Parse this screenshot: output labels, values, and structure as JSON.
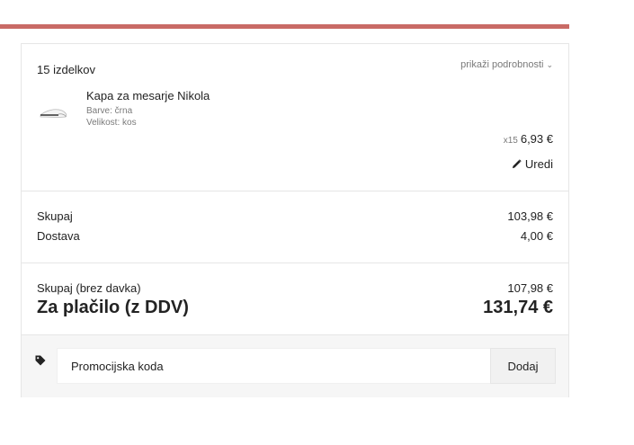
{
  "colors": {
    "accent_bar": "#c96b66"
  },
  "cart": {
    "items_count": "15 izdelkov",
    "show_details": "prikaži podrobnosti",
    "product": {
      "name": "Kapa za mesarje Nikola",
      "color": "Barve: črna",
      "size": "Velikost: kos",
      "quantity": "x15",
      "unit_price": "6,93 €",
      "edit_label": "Uredi"
    }
  },
  "totals": {
    "subtotal_label": "Skupaj",
    "subtotal_value": "103,98 €",
    "shipping_label": "Dostava",
    "shipping_value": "4,00 €",
    "net_label": "Skupaj (brez davka)",
    "net_value": "107,98 €",
    "total_label": "Za plačilo (z DDV)",
    "total_value": "131,74 €"
  },
  "promo": {
    "placeholder": "Promocijska koda",
    "button_label": "Dodaj"
  },
  "icons": {
    "chevron": "chevron-down-icon",
    "edit": "pencil-icon",
    "tag": "tag-icon"
  }
}
